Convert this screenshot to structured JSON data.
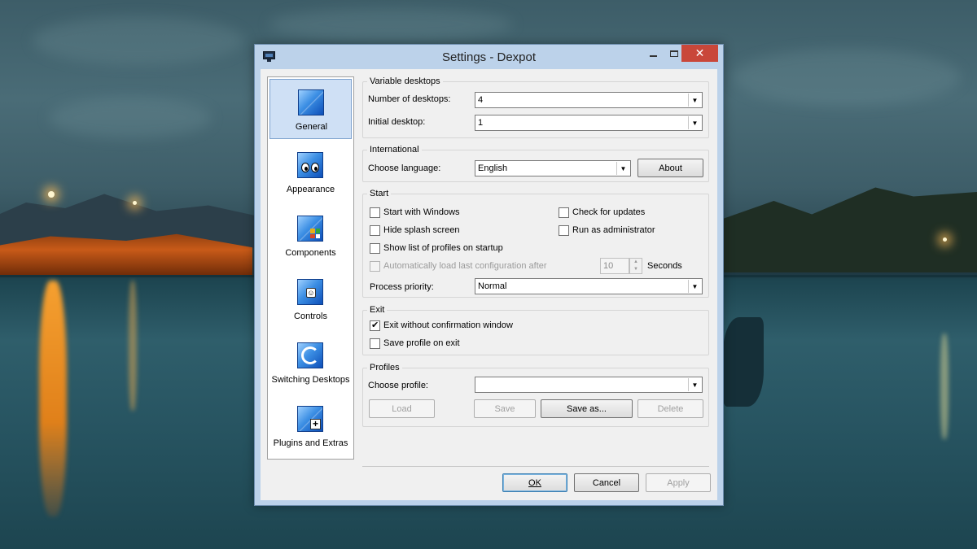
{
  "window": {
    "title": "Settings - Dexpot",
    "close_glyph": "✕"
  },
  "sidebar": {
    "items": [
      {
        "label": "General",
        "icon": "general-icon"
      },
      {
        "label": "Appearance",
        "icon": "appearance-icon"
      },
      {
        "label": "Components",
        "icon": "components-icon"
      },
      {
        "label": "Controls",
        "icon": "controls-icon"
      },
      {
        "label": "Switching Desktops",
        "icon": "switching-desktops-icon"
      },
      {
        "label": "Plugins and Extras",
        "icon": "plugins-icon"
      }
    ],
    "selected": "General"
  },
  "variable_desktops": {
    "title": "Variable desktops",
    "num_label": "Number of desktops:",
    "num_value": "4",
    "initial_label": "Initial desktop:",
    "initial_value": "1"
  },
  "international": {
    "title": "International",
    "language_label": "Choose language:",
    "language_value": "English",
    "about_label": "About"
  },
  "start": {
    "title": "Start",
    "start_with_windows": "Start with Windows",
    "hide_splash": "Hide splash screen",
    "show_profiles": "Show list of profiles on startup",
    "auto_load": "Automatically load last configuration after",
    "check_updates": "Check for updates",
    "run_admin": "Run as administrator",
    "seconds_value": "10",
    "seconds_label": "Seconds",
    "priority_label": "Process priority:",
    "priority_value": "Normal"
  },
  "exit": {
    "title": "Exit",
    "exit_without_confirm": "Exit without confirmation window",
    "exit_without_confirm_checked": true,
    "save_profile": "Save profile on exit"
  },
  "profiles": {
    "title": "Profiles",
    "choose_label": "Choose profile:",
    "choose_value": "",
    "load_label": "Load",
    "save_label": "Save",
    "save_as_label": "Save as...",
    "delete_label": "Delete"
  },
  "footer": {
    "ok_label": "OK",
    "cancel_label": "Cancel",
    "apply_label": "Apply"
  }
}
